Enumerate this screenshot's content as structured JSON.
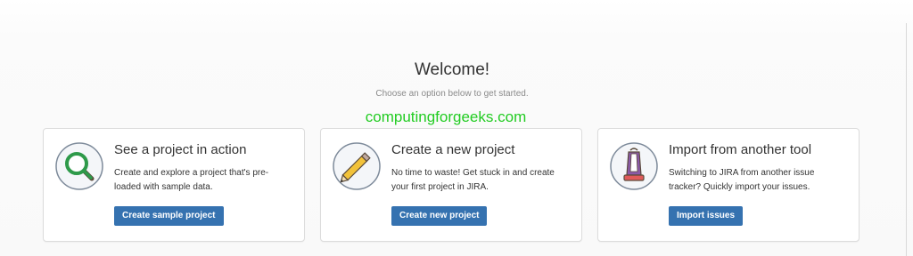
{
  "welcome": {
    "title": "Welcome!",
    "subtitle": "Choose an option below to get started."
  },
  "watermark": "computingforgeeks.com",
  "cards": [
    {
      "title": "See a project in action",
      "description": "Create and explore a project that's pre-loaded with sample data.",
      "button": "Create sample project",
      "icon": "magnifier-icon"
    },
    {
      "title": "Create a new project",
      "description": "No time to waste! Get stuck in and create your first project in JIRA.",
      "button": "Create new project",
      "icon": "pencil-icon"
    },
    {
      "title": "Import from another tool",
      "description": "Switching to JIRA from another issue tracker? Quickly import your issues.",
      "button": "Import issues",
      "icon": "vacuum-cleaner-icon"
    }
  ],
  "colors": {
    "button_bg": "#3572b0",
    "watermark": "#22cc22",
    "icon_circle_fill": "#f4f6f9",
    "icon_circle_stroke": "#7d8a9a"
  }
}
